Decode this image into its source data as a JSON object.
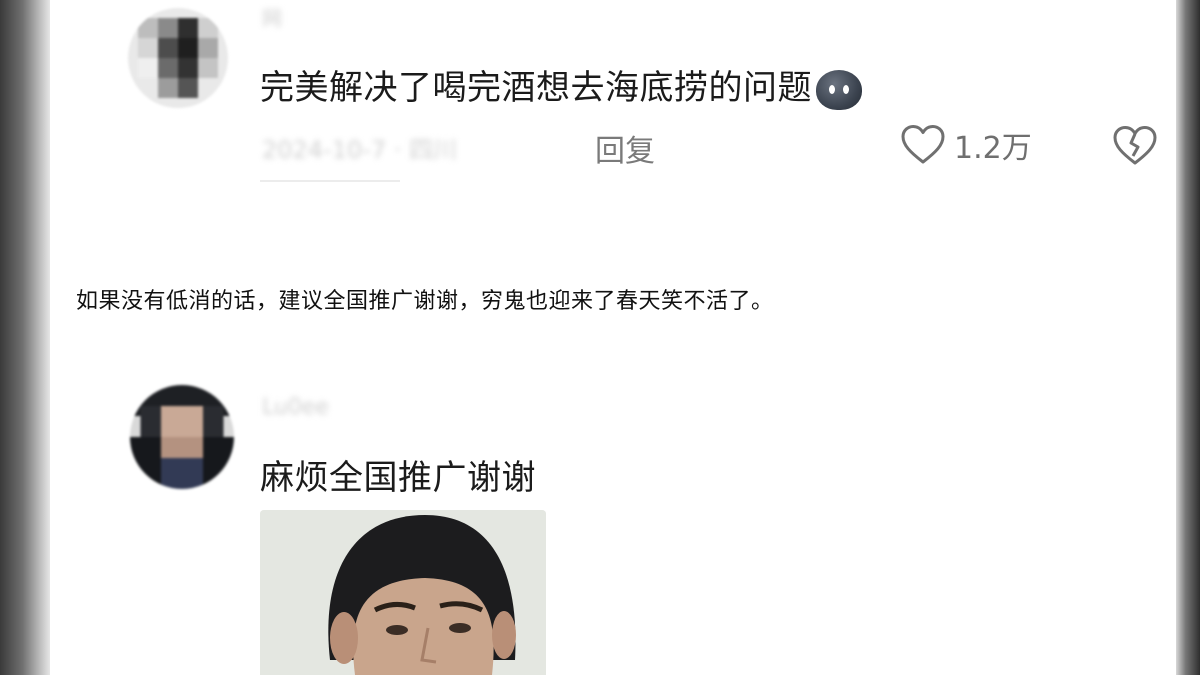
{
  "comment1": {
    "username": "网",
    "text": "完美解决了喝完酒想去海底捞的问题",
    "emoji_icon": "dark-blob-emoji-icon",
    "timestamp": "2024-10-7 · 四川",
    "reply_label": "回复",
    "like_count": "1.2万"
  },
  "caption": {
    "text": "如果没有低消的话，建议全国推广谢谢，穷鬼也迎来了春天笑不活了。"
  },
  "comment2": {
    "username": "Lu0ee",
    "text": "麻烦全国推广谢谢"
  },
  "colors": {
    "text_primary": "#1b1b1b",
    "text_secondary": "#7a7a7a",
    "background": "#ffffff"
  }
}
